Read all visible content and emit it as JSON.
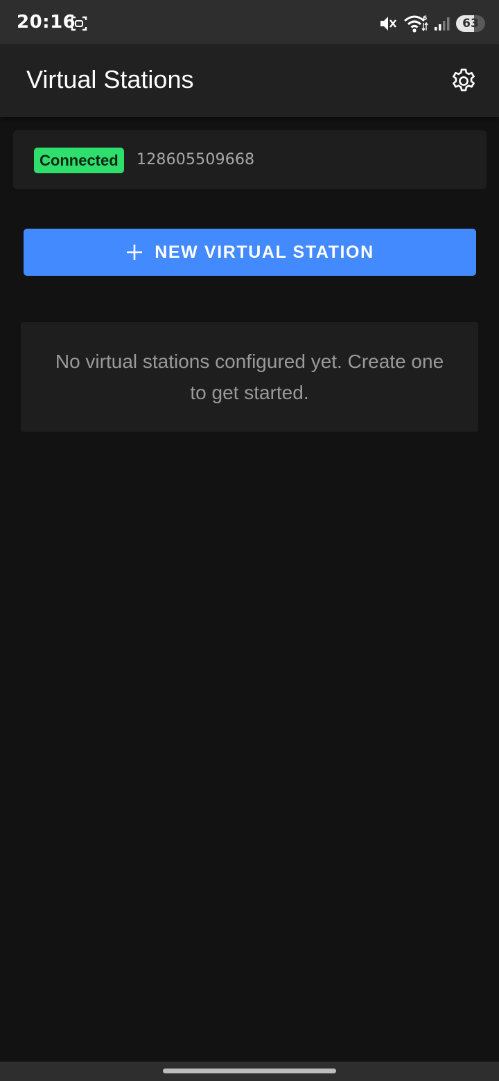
{
  "status_bar": {
    "time": "20:16",
    "battery_level": "63",
    "battery_fraction": 0.63,
    "icons": [
      "screenshot-icon",
      "mute-icon",
      "wifi-icon",
      "signal-icon",
      "battery-icon"
    ]
  },
  "app_bar": {
    "title": "Virtual Stations",
    "settings_icon": "gear-icon"
  },
  "connection": {
    "status": "Connected",
    "station_id": "128605509668",
    "status_color": "#2ee06b"
  },
  "new_station_button": {
    "label": "NEW VIRTUAL STATION",
    "icon": "plus-icon",
    "color": "#448aff"
  },
  "empty_state": {
    "message": "No virtual stations configured yet. Create one to get started."
  }
}
